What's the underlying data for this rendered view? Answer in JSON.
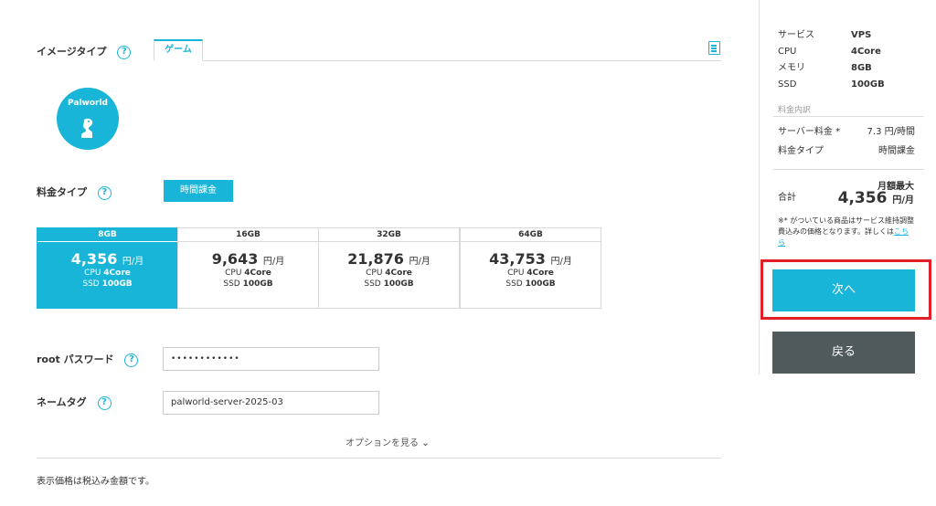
{
  "image_type": {
    "label": "イメージタイプ",
    "help": "?",
    "tab": "ゲーム",
    "icon": "document-list-icon"
  },
  "game": {
    "name": "Palworld",
    "icon": "palworld-figure-icon"
  },
  "pricing_type": {
    "label": "料金タイプ",
    "help": "?",
    "selected": "時間課金"
  },
  "plans": [
    {
      "title": "8GB",
      "price": "4,356",
      "unit": "円/月",
      "cpu_label": "CPU",
      "cpu": "4Core",
      "ssd_label": "SSD",
      "ssd": "100GB",
      "selected": true
    },
    {
      "title": "16GB",
      "price": "9,643",
      "unit": "円/月",
      "cpu_label": "CPU",
      "cpu": "4Core",
      "ssd_label": "SSD",
      "ssd": "100GB",
      "selected": false
    },
    {
      "title": "32GB",
      "price": "21,876",
      "unit": "円/月",
      "cpu_label": "CPU",
      "cpu": "4Core",
      "ssd_label": "SSD",
      "ssd": "100GB",
      "selected": false
    },
    {
      "title": "64GB",
      "price": "43,753",
      "unit": "円/月",
      "cpu_label": "CPU",
      "cpu": "4Core",
      "ssd_label": "SSD",
      "ssd": "100GB",
      "selected": false
    }
  ],
  "root_password": {
    "label": "root パスワード",
    "help": "?",
    "value": "••••••••••••"
  },
  "name_tag": {
    "label": "ネームタグ",
    "help": "?",
    "value": "palworld-server-2025-03"
  },
  "options_link": "オプションを見る",
  "footnote": "表示価格は税込み金額です。",
  "summary": {
    "specs": [
      {
        "key": "サービス",
        "value": "VPS"
      },
      {
        "key": "CPU",
        "value": "4Core"
      },
      {
        "key": "メモリ",
        "value": "8GB"
      },
      {
        "key": "SSD",
        "value": "100GB"
      }
    ],
    "breakdown_label": "料金内訳",
    "server_fee_label": "サーバー料金 *",
    "server_fee_value": "7.3 円/時間",
    "fee_type_label": "料金タイプ",
    "fee_type_value": "時間課金",
    "max_label": "月額最大",
    "total_label": "合計",
    "total_price": "4,356",
    "total_unit": "円/月",
    "note_text": "※* がついている商品はサービス維持調整費込みの価格となります。詳しくは",
    "note_link": "こちら"
  },
  "buttons": {
    "next": "次へ",
    "back": "戻る"
  },
  "colors": {
    "accent": "#19b5d8",
    "back_button": "#505a5c",
    "highlight": "#e01f26"
  }
}
